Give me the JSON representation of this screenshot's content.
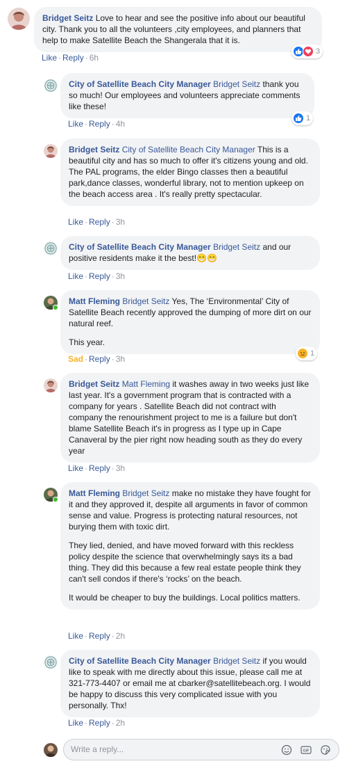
{
  "comments": [
    {
      "author": "Bridget Seitz",
      "mention": "",
      "paragraphs": [
        "Love to hear and see the positive info about our beautiful city. Thank you to all the volunteers ,city employees, and planners that help to make Satellite Beach the Shangerala that it is."
      ],
      "like": "Like",
      "reply": "Reply",
      "time": "6h",
      "reaction_count": "3"
    },
    {
      "author": "City of Satellite Beach City Manager",
      "mention": "Bridget Seitz",
      "paragraphs": [
        "thank you so much! Our employees and volunteers appreciate comments like these!"
      ],
      "like": "Like",
      "reply": "Reply",
      "time": "4h",
      "reaction_count": "1"
    },
    {
      "author": "Bridget Seitz",
      "mention": "City of Satellite Beach City Manager",
      "paragraphs": [
        "This is a beautiful city and has so much to offer it's citizens young and old. The PAL programs, the elder Bingo classes then a beautiful park,dance classes, wonderful library, not to mention upkeep on the beach access area . It's really pretty spectacular."
      ],
      "like": "Like",
      "reply": "Reply",
      "time": "3h"
    },
    {
      "author": "City of Satellite Beach City Manager",
      "mention": "Bridget Seitz",
      "paragraphs": [
        "and our positive residents make it the best!😁😁"
      ],
      "like": "Like",
      "reply": "Reply",
      "time": "3h"
    },
    {
      "author": "Matt Fleming",
      "mention": "Bridget Seitz",
      "paragraphs": [
        "Yes, The ‘Environmental’ City of Satellite Beach recently approved the dumping of more dirt on our natural reef.",
        "This year."
      ],
      "like": "Sad",
      "reply": "Reply",
      "time": "3h",
      "reaction_count": "1"
    },
    {
      "author": "Bridget Seitz",
      "mention": "Matt Fleming",
      "paragraphs": [
        "it washes away in two weeks just like last year. It's a government program that is contracted with a company for years . Satellite Beach did not contract with company the renourishment project to me is a failure but don't blame Satellite Beach it's in progress as I type up in Cape Canaveral by the pier right now heading south as they do every year"
      ],
      "like": "Like",
      "reply": "Reply",
      "time": "3h"
    },
    {
      "author": "Matt Fleming",
      "mention": "Bridget Seitz",
      "paragraphs": [
        "make no mistake they have fought for it and they approved it, despite all arguments in favor of common sense and value. Progress is protecting natural resources, not burying them with toxic dirt.",
        "They lied, denied, and have moved forward with this reckless policy despite the science that overwhelmingly says its a bad thing. They did this because a few real estate people think they can't sell condos if there's ‘rocks’ on the beach.",
        "It would be cheaper to buy the buildings. Local politics matters."
      ],
      "like": "Like",
      "reply": "Reply",
      "time": "2h"
    },
    {
      "author": "City of Satellite Beach City Manager",
      "mention": "Bridget Seitz",
      "paragraphs": [
        "if you would like to speak with me directly about this issue, please call me at 321-773-4407 or email me at cbarker@satellitebeach.org. I would be happy to discuss this very complicated issue with you personally. Thx!"
      ],
      "like": "Like",
      "reply": "Reply",
      "time": "2h"
    }
  ],
  "reply_box": {
    "placeholder": "Write a reply..."
  },
  "icons": {
    "like": "like-reaction-icon",
    "love": "love-reaction-icon",
    "sad": "sad-reaction-icon",
    "emoji": "emoji-icon",
    "gif": "gif-icon",
    "sticker": "sticker-icon"
  },
  "colors": {
    "link": "#385898",
    "meta": "#90949c",
    "bubble": "#f2f3f5",
    "like_blue": "#1877f2",
    "love_red": "#f33e58",
    "sad_yellow": "#f7b125",
    "online_green": "#42b72a"
  }
}
